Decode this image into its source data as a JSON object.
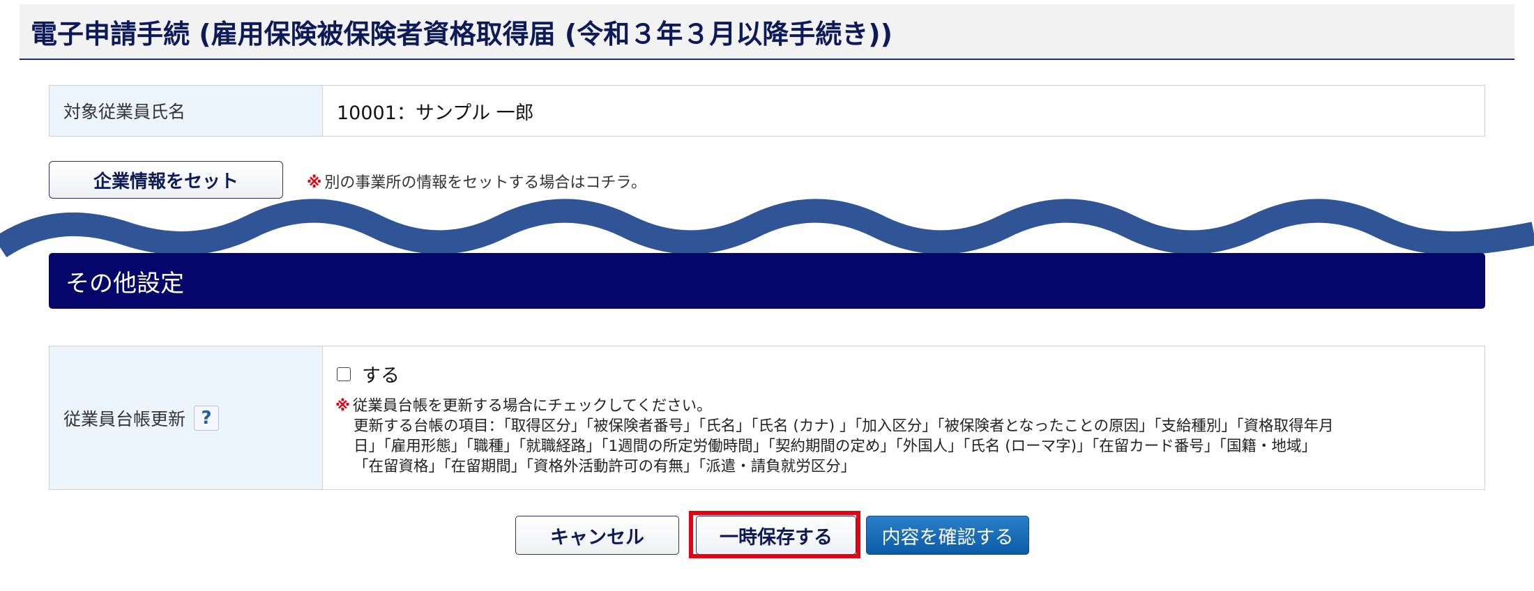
{
  "header": {
    "title": "電子申請手続 (雇用保険被保険者資格取得届 (令和３年３月以降手続き))"
  },
  "employee_row": {
    "label": "対象従業員氏名",
    "value": "10001：サンプル 一郎"
  },
  "company_set": {
    "button_label": "企業情報をセット",
    "note_mark": "※",
    "note_text": "別の事業所の情報をセットする場合はコチラ。"
  },
  "section": {
    "title": "その他設定"
  },
  "ledger_row": {
    "label": "従業員台帳更新",
    "help_icon": "?",
    "checkbox_label": "する",
    "checkbox_checked": false,
    "note_mark": "※",
    "note_line1": "従業員台帳を更新する場合にチェックしてください。",
    "note_line2": "更新する台帳の項目：「取得区分」「被保険者番号」「氏名」「氏名 (カナ) 」「加入区分」「被保険者となったことの原因」「支給種別」「資格取得年月",
    "note_line3": "日」「雇用形態」「職種」「就職経路」「1週間の所定労働時間」「契約期間の定め」「外国人」「氏名 (ローマ字)」「在留カード番号」「国籍・地域」",
    "note_line4": "「在留資格」「在留期間」「資格外活動許可の有無」「派遣・請負就労区分」"
  },
  "footer_buttons": {
    "cancel": "キャンセル",
    "save": "一時保存する",
    "confirm": "内容を確認する"
  },
  "colors": {
    "title_text": "#0c1a5a",
    "section_bg": "#06066a",
    "wave": "#2f5597",
    "highlight": "#e60012",
    "confirm_bg": "#0d5ba6"
  }
}
